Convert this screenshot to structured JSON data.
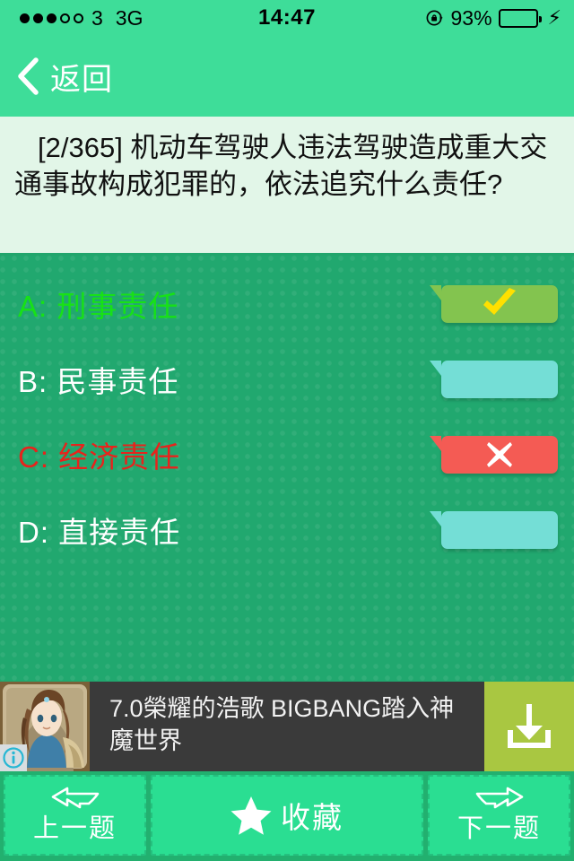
{
  "statusbar": {
    "carrier": "3",
    "network": "3G",
    "time": "14:47",
    "battery_percent": "93%",
    "battery_level": 93,
    "signal_dots_filled": 3,
    "signal_dots_total": 5,
    "rotation_lock_icon": "rotation-lock-icon",
    "charging_bolt_icon": "charging-bolt-icon",
    "battery_icon": "battery-icon",
    "bolt_glyph": "⚡"
  },
  "navbar": {
    "back_label": "返回",
    "back_icon": "chevron-left-icon"
  },
  "question": {
    "text": "[2/365] 机动车驾驶人违法驾驶造成重大交通事故构成犯罪的，依法追究什么责任?",
    "index": "2",
    "total": "365"
  },
  "options": [
    {
      "label": "A: 刑事责任",
      "state": "correct",
      "badge_icon": "check-icon",
      "text_color": "#17e117",
      "badge_color": "#83c44f"
    },
    {
      "label": "B: 民事责任",
      "state": "neutral",
      "badge_icon": "none",
      "text_color": "#ffffff",
      "badge_color": "#74ded6"
    },
    {
      "label": "C: 经济责任",
      "state": "incorrect",
      "badge_icon": "cross-icon",
      "text_color": "#e8231c",
      "badge_color": "#f45b54"
    },
    {
      "label": "D: 直接责任",
      "state": "neutral",
      "badge_icon": "none",
      "text_color": "#ffffff",
      "badge_color": "#74ded6"
    }
  ],
  "ad": {
    "title": "7.0榮耀的浩歌 BIGBANG踏入神魔世界",
    "icon_name": "app-icon-anime-character",
    "info_icon": "info-icon",
    "download_icon": "download-icon",
    "cta_color": "#a9c741"
  },
  "toolbar": {
    "prev_label": "上一题",
    "prev_icon": "arrow-left-icon",
    "fav_label": "收藏",
    "fav_icon": "star-icon",
    "next_label": "下一题",
    "next_icon": "arrow-right-icon"
  },
  "theme": {
    "header_green": "#3edd99",
    "body_green": "#21a86f",
    "question_bg": "#e2f6e8",
    "toolbar_green": "#2ade92"
  }
}
